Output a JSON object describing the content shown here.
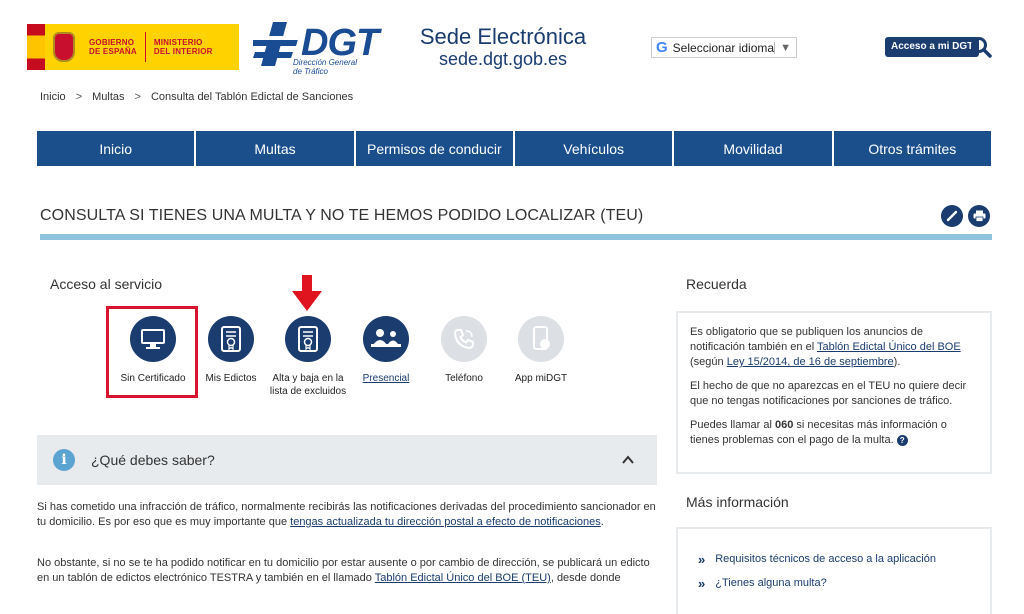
{
  "header": {
    "gov_line1": "GOBIERNO",
    "gov_line2": "DE ESPAÑA",
    "min_line1": "MINISTERIO",
    "min_line2": "DEL INTERIOR",
    "dgt_word": "DGT",
    "dgt_sub1": "Dirección General",
    "dgt_sub2": "de Tráfico",
    "sede_title": "Sede Electrónica",
    "sede_url": "sede.dgt.gob.es",
    "translate_label": "Seleccionar idioma",
    "acceso_label": "Acceso a mi DGT"
  },
  "breadcrumb": [
    "Inicio",
    "Multas",
    "Consulta del Tablón Edictal de Sanciones"
  ],
  "nav": [
    "Inicio",
    "Multas",
    "Permisos de conducir",
    "Vehículos",
    "Movilidad",
    "Otros trámites"
  ],
  "page_title": "CONSULTA SI TIENES UNA MULTA Y NO TE HEMOS PODIDO LOCALIZAR (TEU)",
  "acceso": {
    "heading": "Acceso al servicio",
    "services": [
      {
        "label": "Sin Certificado",
        "icon": "monitor-icon",
        "enabled": true
      },
      {
        "label": "Mis Edictos",
        "icon": "certificate-document-icon",
        "enabled": true
      },
      {
        "label": "Alta y baja en la lista de excluidos",
        "icon": "certificate-document-icon",
        "enabled": true
      },
      {
        "label": "Presencial",
        "icon": "people-desk-icon",
        "enabled": true
      },
      {
        "label": "Teléfono",
        "icon": "phone-icon",
        "enabled": false
      },
      {
        "label": "App miDGT",
        "icon": "mobile-app-icon",
        "enabled": false
      }
    ]
  },
  "accordion": {
    "title": "¿Qué debes saber?"
  },
  "paragraphs": {
    "p1_a": "Si has cometido una infracción de tráfico, normalmente recibirás las notificaciones derivadas del procedimiento sancionador en tu domicilio. Es por eso que es muy importante que ",
    "p1_link": "tengas actualizada tu dirección postal a efecto de notificaciones",
    "p1_b": ".",
    "p2_a": "No obstante, si no se te ha podido notificar en tu domicilio por estar ausente o por cambio de dirección, se publicará un edicto en un tablón de edictos electrónico TESTRA y también en el llamado ",
    "p2_link": "Tablón Edictal Único del BOE (TEU)",
    "p2_b": ", desde donde"
  },
  "recuerda": {
    "heading": "Recuerda",
    "p1_a": "Es obligatorio que se publiquen los anuncios de notificación también en el ",
    "p1_link1": "Tablón Edictal Único del BOE",
    "p1_b": " (según ",
    "p1_link2": "Ley 15/2014, de 16 de septiembre",
    "p1_c": ").",
    "p2": "El hecho de que no aparezcas en el TEU no quiere decir que no tengas notificaciones por sanciones de tráfico.",
    "p3_a": "Puedes llamar al ",
    "p3_num": "060",
    "p3_b": " si necesitas más información o tienes problemas con el pago de la multa. "
  },
  "mas_info": {
    "heading": "Más información",
    "items": [
      "Requisitos técnicos de acceso a la aplicación",
      "¿Tienes alguna multa?"
    ]
  },
  "colors": {
    "primary": "#1a3c6e",
    "nav_blue": "#1b4f8c",
    "accent_light_blue": "#8ec4de",
    "highlight_red": "#d7142d"
  }
}
